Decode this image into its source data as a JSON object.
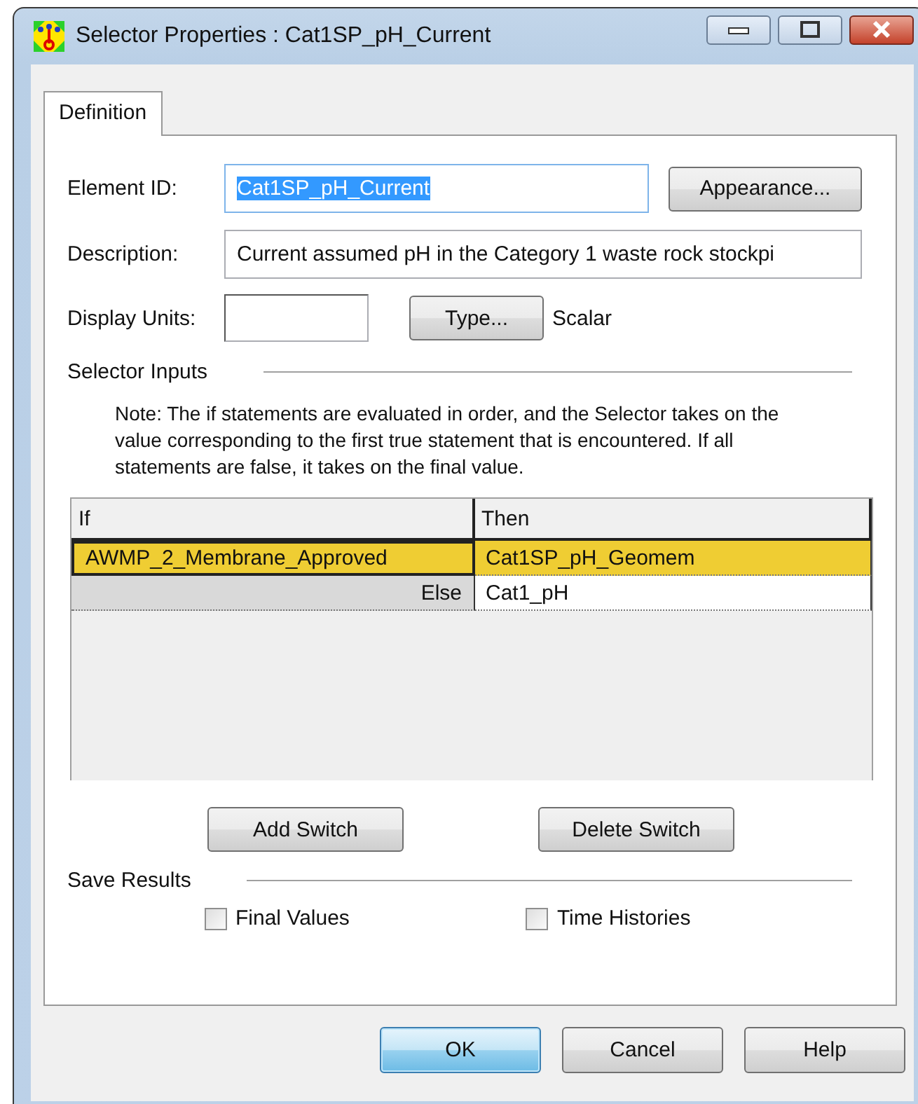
{
  "window": {
    "title": "Selector Properties : Cat1SP_pH_Current"
  },
  "tabs": [
    {
      "label": "Definition",
      "selected": true
    }
  ],
  "element_id": {
    "label": "Element ID:",
    "value": "Cat1SP_pH_Current",
    "selected": true
  },
  "appearance_button": "Appearance...",
  "description": {
    "label": "Description:",
    "value": "Current assumed pH in the Category 1 waste rock stockpi"
  },
  "display_units": {
    "label": "Display Units:"
  },
  "type_button": "Type...",
  "type_value": "Scalar",
  "selector_inputs": {
    "heading": "Selector Inputs",
    "note": "Note: The if statements are evaluated in order, and the Selector takes on the value corresponding to the first true statement that is encountered. If all statements are false, it takes on the final value."
  },
  "table": {
    "columns": [
      "If",
      "Then"
    ],
    "rows": [
      {
        "kind": "condition",
        "if": "AWMP_2_Membrane_Approved",
        "then": "Cat1SP_pH_Geomem",
        "selected": true
      },
      {
        "kind": "else",
        "if": "Else",
        "then": "Cat1_pH",
        "selected": false
      }
    ]
  },
  "switch_buttons": [
    "Add Switch",
    "Delete Switch"
  ],
  "save_results": {
    "heading": "Save Results",
    "options": [
      {
        "label": "Final Values",
        "checked": false
      },
      {
        "label": "Time Histories",
        "checked": false
      }
    ]
  },
  "buttons": [
    {
      "label": "OK",
      "default": true
    },
    {
      "label": "Cancel",
      "default": false
    },
    {
      "label": "Help",
      "default": false
    }
  ]
}
